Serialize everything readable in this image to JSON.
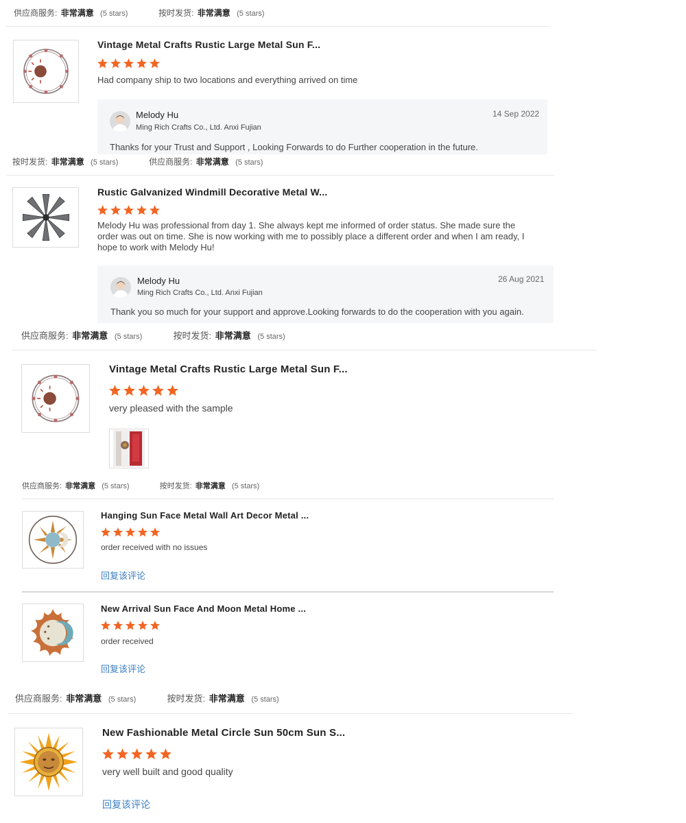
{
  "ratings": {
    "supplier_service_label": "供应商服务:",
    "on_time_label": "按时发货:",
    "value": "非常满意",
    "stars_text": "(5 stars)"
  },
  "reply_link_label": "回复该评论",
  "colors": {
    "star": "#f26522",
    "link": "#3c7fc2",
    "reply_bg": "#f5f6f8"
  },
  "reviews": [
    {
      "title": "Vintage Metal Crafts Rustic Large Metal Sun F...",
      "rating": 5,
      "text": "Had company ship to two locations and everything arrived on time",
      "thumb_icon": "sun-moon-icon",
      "reply": {
        "seller": "Melody Hu",
        "company": "Ming Rich Crafts Co., Ltd. Anxi Fujian",
        "date": "14 Sep 2022",
        "text": "Thanks for your Trust and Support ,  Looking Forwards to do Further cooperation in the future."
      }
    },
    {
      "title": "Rustic Galvanized Windmill Decorative Metal W...",
      "rating": 5,
      "text": "Melody Hu was professional from day 1.  She always kept me informed of order status.  She made sure the order was out on time. She is now working with me to possibly place a different order and when I am ready, I hope to work with Melody Hu!",
      "thumb_icon": "windmill-icon",
      "reply": {
        "seller": "Melody Hu",
        "company": "Ming Rich Crafts Co., Ltd. Anxi Fujian",
        "date": "26 Aug 2021",
        "text": "Thank you so much for your support and approve.Looking forwards to do the cooperation with you again."
      }
    },
    {
      "title": "Vintage Metal Crafts Rustic Large Metal Sun F...",
      "rating": 5,
      "text": "very pleased with the sample",
      "thumb_icon": "sun-moon-icon",
      "photo_icon": "review-photo-icon"
    },
    {
      "title": "Hanging Sun Face Metal Wall Art Decor Metal ...",
      "rating": 5,
      "text": "order received with no issues",
      "thumb_icon": "sun-face-ring-icon"
    },
    {
      "title": "New Arrival Sun Face And Moon Metal Home ...",
      "rating": 5,
      "text": "order received",
      "thumb_icon": "sun-face-moon-icon"
    },
    {
      "title": "New Fashionable Metal Circle Sun 50cm Sun S...",
      "rating": 5,
      "text": "very well built and good quality",
      "thumb_icon": "golden-sun-icon"
    }
  ]
}
